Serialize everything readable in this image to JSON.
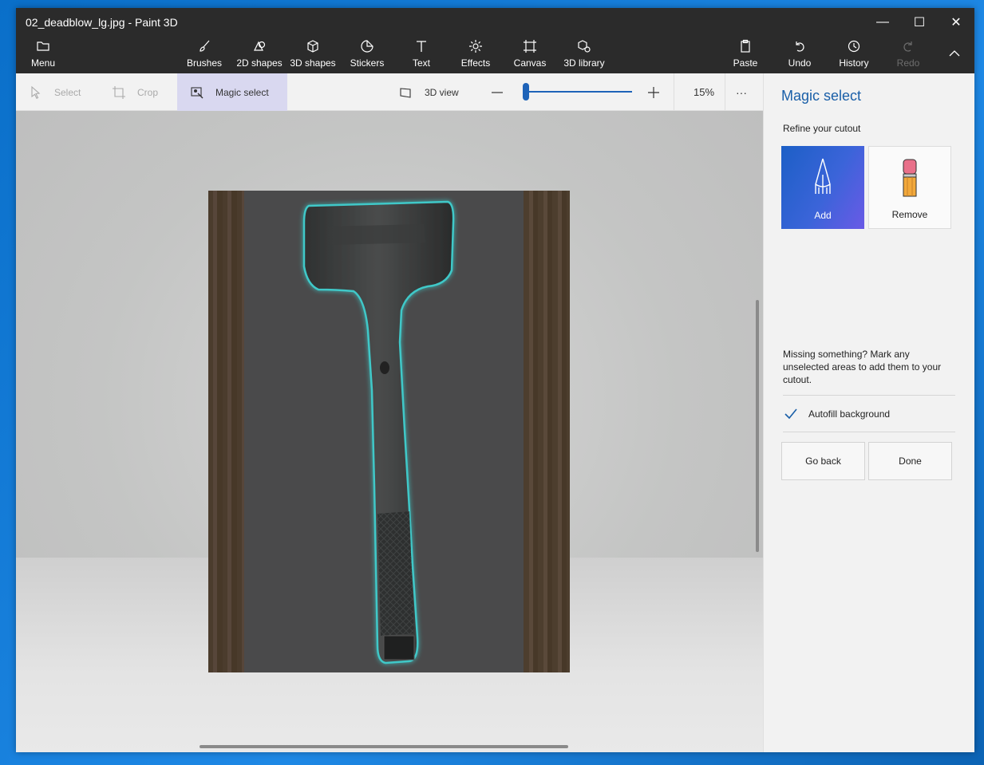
{
  "window": {
    "title": "02_deadblow_lg.jpg  - Paint 3D",
    "controls": {
      "minimize": "—",
      "maximize": "☐",
      "close": "✕"
    }
  },
  "ribbon": {
    "menu": "Menu",
    "tools": [
      "Brushes",
      "2D shapes",
      "3D shapes",
      "Stickers",
      "Text",
      "Effects",
      "Canvas",
      "3D library"
    ],
    "paste": "Paste",
    "undo": "Undo",
    "history": "History",
    "redo": "Redo"
  },
  "toolbar": {
    "select": "Select",
    "crop": "Crop",
    "magic_select": "Magic select",
    "view_3d": "3D view",
    "zoom_value": "15%",
    "zoom_level": 0.15,
    "more": "···"
  },
  "panel": {
    "title": "Magic select",
    "subtitle": "Refine your cutout",
    "add_label": "Add",
    "remove_label": "Remove",
    "hint": "Missing something? Mark any unselected areas to add them to your cutout.",
    "autofill_label": "Autofill background",
    "autofill_checked": true,
    "go_back": "Go back",
    "done": "Done"
  },
  "colors": {
    "accent": "#1a5fa8",
    "ribbon_bg": "#2b2b2b",
    "selection_glow": "#3fc8c8"
  }
}
